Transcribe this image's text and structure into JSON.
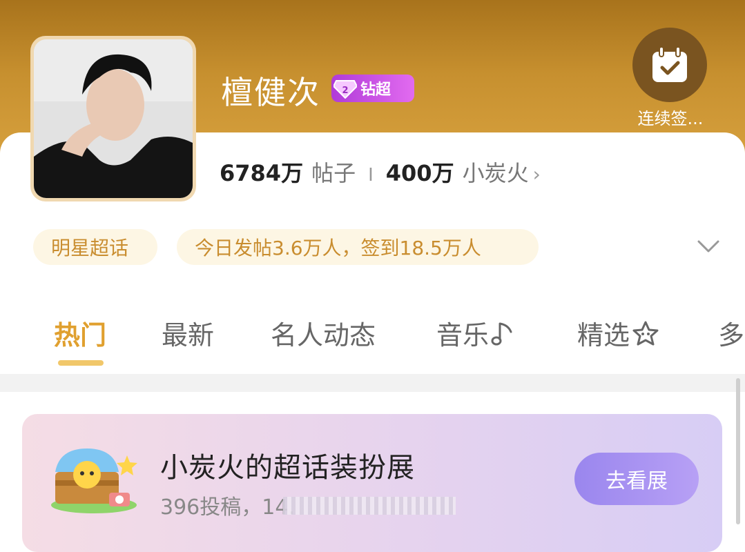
{
  "header": {
    "title": "檀健次",
    "badge_label": "钻超",
    "checkin_label": "连续签..."
  },
  "stats": {
    "posts_count": "6784万",
    "posts_unit": "帖子",
    "separator": "I",
    "fire_count": "400万",
    "fire_unit": "小炭火",
    "chevron": "›"
  },
  "info": {
    "category": "明星超话",
    "activity": "今日发帖3.6万人，签到18.5万人"
  },
  "tabs": [
    {
      "label": "热门"
    },
    {
      "label": "最新"
    },
    {
      "label": "名人动态"
    },
    {
      "label": "音乐"
    },
    {
      "label": "精选"
    },
    {
      "label": "多"
    }
  ],
  "banner": {
    "title": "小炭火的超话装扮展",
    "subtitle": "396投稿，14.",
    "button_label": "去看展"
  },
  "icons": {
    "checkin": "calendar-check-icon",
    "badge": "diamond-icon",
    "expand": "chevron-down-icon",
    "music": "music-note-icon",
    "featured": "star-icon"
  },
  "colors": {
    "header_gold": "#c7902f",
    "accent": "#e0a02f",
    "badge_purple": "#c04be0",
    "button_purple": "#9a86ee"
  }
}
